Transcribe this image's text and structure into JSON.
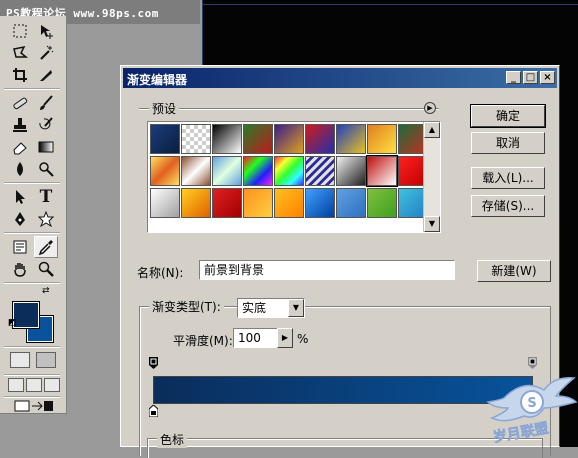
{
  "watermark": "PS教程论坛  www.98ps.com",
  "colors": {
    "foreground": "#0a2d5a",
    "background": "#08539c",
    "titlebar": "#0a246a",
    "dialog_bg": "#d4d0c8"
  },
  "tools_palette": {
    "tools": [
      "marquee-tool",
      "move-tool",
      "lasso-tool",
      "magic-wand-tool",
      "crop-tool",
      "slice-tool",
      "healing-brush-tool",
      "brush-tool",
      "clone-stamp-tool",
      "history-brush-tool",
      "eraser-tool",
      "gradient-tool",
      "blur-tool",
      "dodge-tool",
      "path-selection-tool",
      "type-tool",
      "pen-tool",
      "shape-tool",
      "notes-tool",
      "eyedropper-tool",
      "hand-tool",
      "zoom-tool"
    ],
    "selected_tool": "eyedropper-tool",
    "type_tool_glyph": "T"
  },
  "dialog": {
    "title": "渐变编辑器",
    "window_controls": [
      "_",
      "□",
      "×"
    ],
    "presets_label": "预设",
    "buttons": {
      "ok": "确定",
      "cancel": "取消",
      "load": "载入(L)...",
      "save": "存储(S)...",
      "new": "新建(W)"
    },
    "name_label": "名称(N):",
    "name_value": "前景到背景",
    "gradient_type_label": "渐变类型(T):",
    "gradient_type_value": "实底",
    "smoothness_label": "平滑度(M):",
    "smoothness_value": "100",
    "smoothness_unit": "%",
    "color_stops_label": "色标",
    "gradient": {
      "start": "#0a2d5a",
      "end": "#08539c"
    }
  },
  "preset_swatches": [
    "linear-gradient(135deg,#1a3d7a,#0a1e40)",
    "repeating-conic-gradient(#ccc 0 25%,#fff 0 50%) 0 0/8px 8px",
    "linear-gradient(135deg,#000,#fff)",
    "linear-gradient(135deg,#2b7a2b,#c01a1a)",
    "linear-gradient(135deg,#3a1e8a,#e0a020)",
    "linear-gradient(135deg,#d01a1a,#2030b0)",
    "linear-gradient(135deg,#2040c0,#e8c020)",
    "linear-gradient(135deg,#e08020,#ffe040)",
    "linear-gradient(135deg,#1e6a3a,#c03020)",
    "linear-gradient(135deg,#ffe060,#e06020,#ffe060)",
    "linear-gradient(135deg,#8a5030,#ffffff,#8a5030)",
    "linear-gradient(135deg,#60a0e0,#e0ffe0,#60a0e0)",
    "linear-gradient(135deg,#ff2020,#20ff20,#2020ff,#ff20ff)",
    "linear-gradient(135deg,#ff3030,#ffff30,#30ff30,#30ffff,#3030ff)",
    "repeating-linear-gradient(135deg,#e0e0e0 0 3px,#2a2a9a 3px 6px)",
    "linear-gradient(135deg,#f0f0f0,#202020)",
    "linear-gradient(135deg,#c01010,#ffffff)",
    "linear-gradient(135deg,#ff2020,#c00000)",
    "linear-gradient(135deg,#ffffff,#a0a0a0)",
    "linear-gradient(135deg,#ffd020,#e06000)",
    "linear-gradient(135deg,#e02020,#a00000)",
    "linear-gradient(135deg,#ff9020,#ffd040)",
    "linear-gradient(135deg,#ffc020,#ff8000)",
    "linear-gradient(135deg,#40a0ff,#0040a0)",
    "linear-gradient(135deg,#60a0e0,#3070c0)",
    "linear-gradient(135deg,#80c040,#40a020)",
    "linear-gradient(135deg,#40c0e0,#2080c0)"
  ],
  "brand_logo_text": "岁月联盟"
}
